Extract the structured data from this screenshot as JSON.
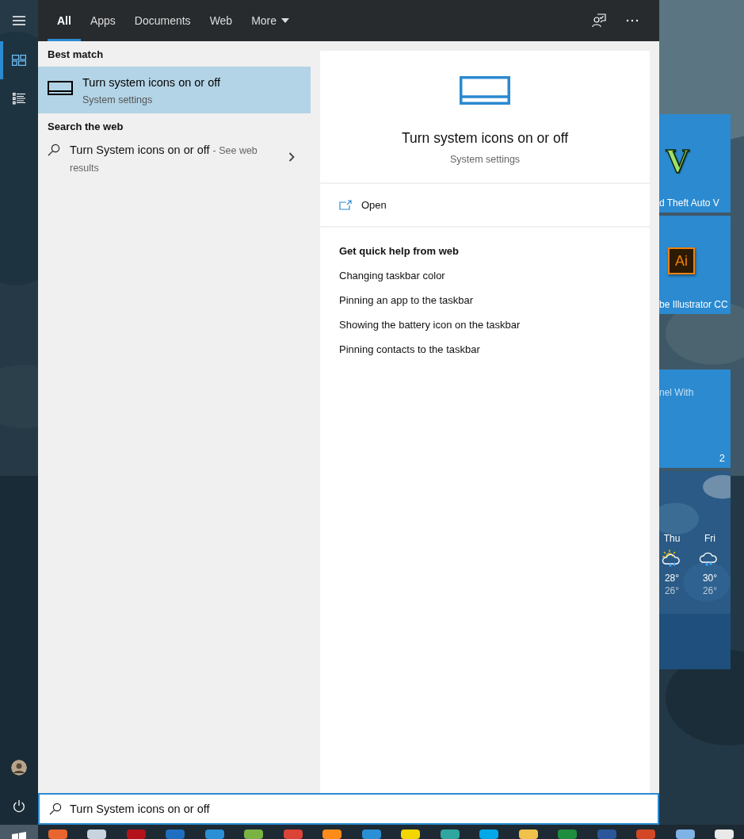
{
  "sidebar": {
    "items": [
      {
        "kind": "menu",
        "selected": false
      },
      {
        "kind": "home",
        "selected": true
      },
      {
        "kind": "documents",
        "selected": false
      }
    ],
    "bottom_items": [
      {
        "kind": "avatar"
      },
      {
        "kind": "power"
      }
    ]
  },
  "tabs": [
    {
      "label": "All",
      "selected": true
    },
    {
      "label": "Apps",
      "selected": false
    },
    {
      "label": "Documents",
      "selected": false
    },
    {
      "label": "Web",
      "selected": false
    },
    {
      "label": "More",
      "selected": false,
      "dropdown": true
    }
  ],
  "best_match": {
    "heading": "Best match",
    "title": "Turn system icons on or off",
    "subtitle": "System settings",
    "selected": true
  },
  "web_search": {
    "heading": "Search the web",
    "query": "Turn System icons on or off",
    "hint": "- See web results"
  },
  "preview": {
    "title": "Turn system icons on or off",
    "subtitle": "System settings",
    "action": "Open",
    "help_heading": "Get quick help from web",
    "help_links": [
      "Changing taskbar color",
      "Pinning an app to the taskbar",
      "Showing the battery icon on the taskbar",
      "Pinning contacts to the taskbar"
    ]
  },
  "search_box": {
    "value": "Turn System icons on or off"
  },
  "tiles": [
    {
      "kind": "game",
      "logo": "V",
      "label": "d Theft Auto V"
    },
    {
      "kind": "app",
      "logo": "Ai",
      "label": "be Illustrator CC"
    },
    {
      "kind": "live",
      "label": "nel With",
      "count": "2"
    },
    {
      "kind": "weather",
      "days": [
        {
          "day": "Thu",
          "kind": "sun-rain",
          "high": "28°",
          "low": "26°"
        },
        {
          "day": "Fri",
          "kind": "rain",
          "high": "30°",
          "low": "26°"
        }
      ]
    }
  ]
}
